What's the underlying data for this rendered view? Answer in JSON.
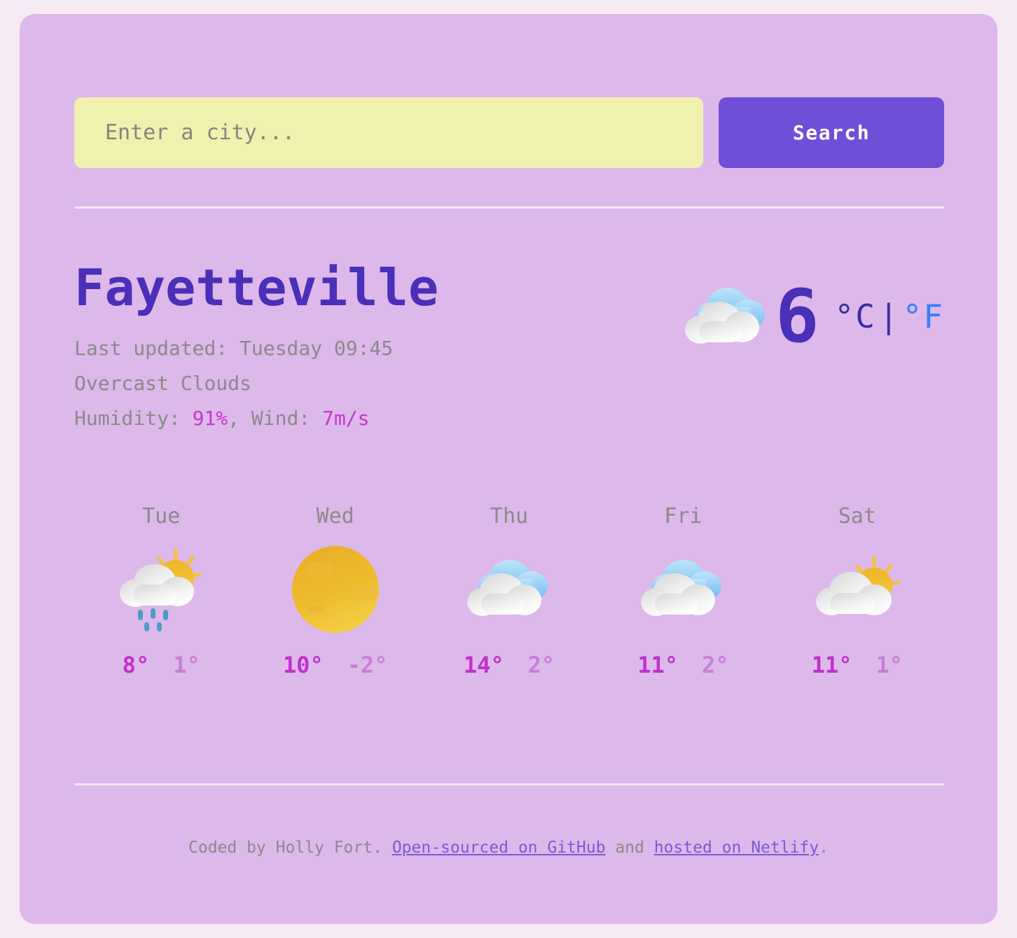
{
  "theme": {
    "page_background": "#F6EBF4",
    "card_background": "#DDB8EA",
    "accent_purple": "#6F4FD8",
    "heading_purple": "#4A2FB8",
    "input_yellow": "#F0F0AF",
    "magenta": "#C636CF",
    "min_temp_purple": "#C77FD6",
    "unit_inactive_blue": "#3B7DFB",
    "muted_gray": "#8A8A8A"
  },
  "search": {
    "placeholder": "Enter a city...",
    "value": "",
    "button_label": "Search"
  },
  "current": {
    "city": "Fayetteville",
    "last_updated_label": "Last updated: Tuesday 09:45",
    "description": "Overcast Clouds",
    "humidity_prefix": "Humidity: ",
    "humidity_value": "91%",
    "wind_prefix": ", Wind: ",
    "wind_value": "7m/s",
    "temperature": "6",
    "icon": "overcast-clouds-icon",
    "units": {
      "celsius_label": "°C",
      "separator": "|",
      "fahrenheit_label": "°F",
      "active": "celsius"
    }
  },
  "forecast": {
    "days": [
      {
        "label": "Tue",
        "icon": "sun-behind-rain-cloud-icon",
        "max": "8°",
        "min": "1°"
      },
      {
        "label": "Wed",
        "icon": "sun-icon",
        "max": "10°",
        "min": "-2°"
      },
      {
        "label": "Thu",
        "icon": "cloud-icon",
        "max": "14°",
        "min": "2°"
      },
      {
        "label": "Fri",
        "icon": "cloud-icon",
        "max": "11°",
        "min": "2°"
      },
      {
        "label": "Sat",
        "icon": "sun-behind-cloud-icon",
        "max": "11°",
        "min": "1°"
      }
    ]
  },
  "footer": {
    "credit": "Coded by Holly Fort.",
    "github_link": "Open-sourced on GitHub",
    "conjunction": "and",
    "netlify_link": "hosted on Netlify",
    "period": "."
  }
}
